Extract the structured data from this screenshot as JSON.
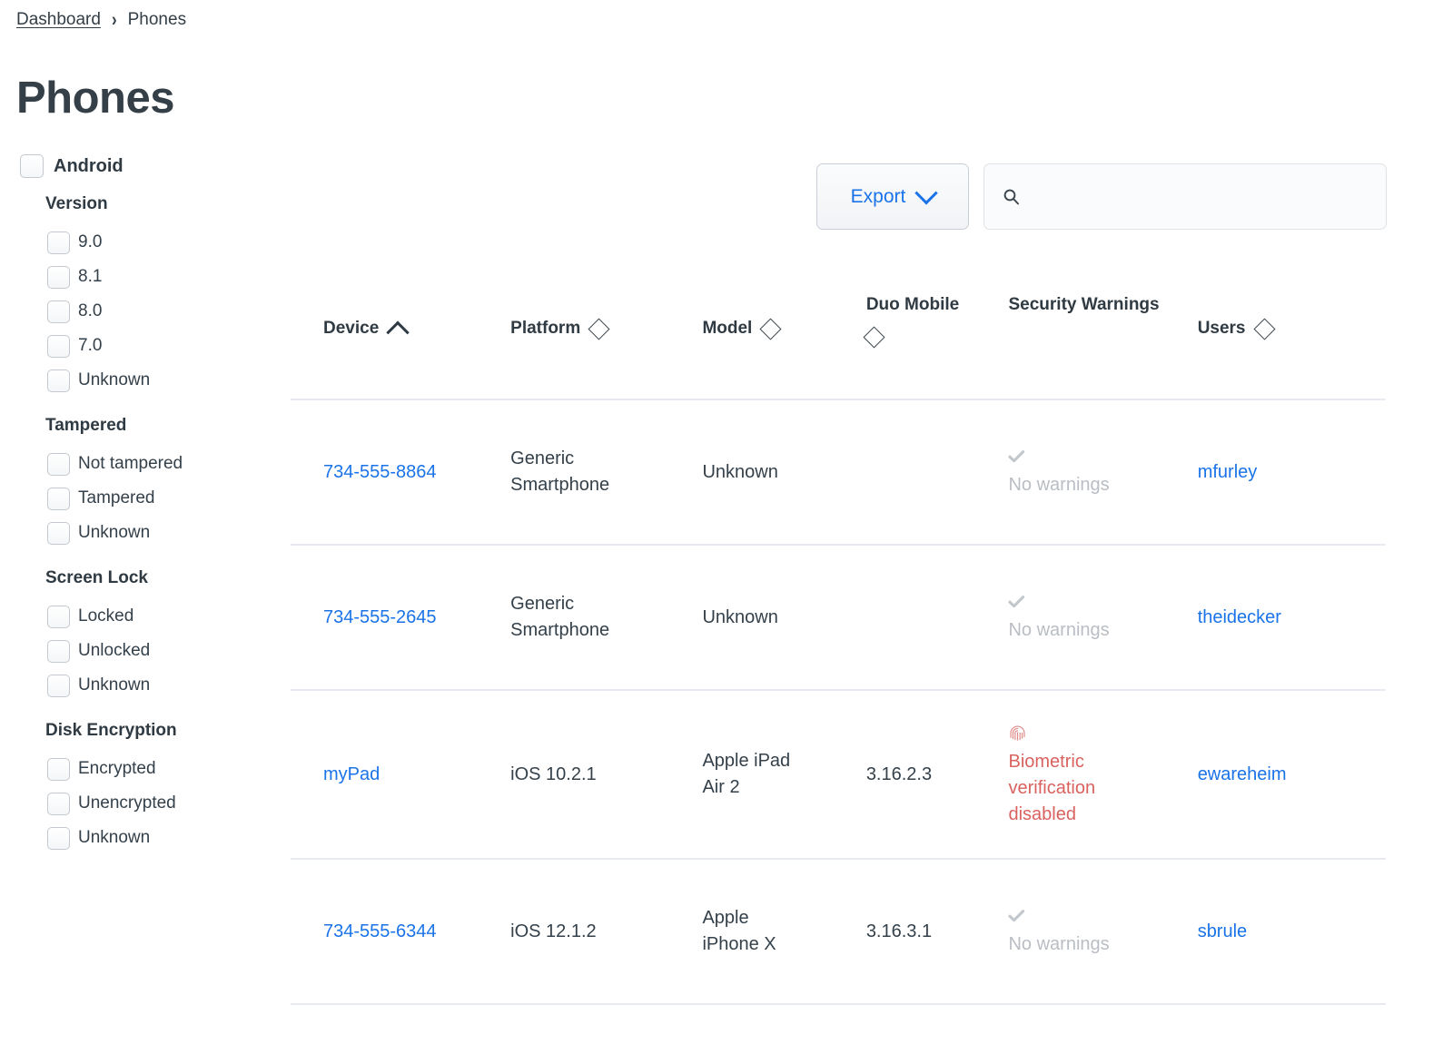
{
  "breadcrumb": {
    "parent": "Dashboard",
    "separator": "›",
    "current": "Phones"
  },
  "page": {
    "title": "Phones",
    "accent_color": "#1a73e8",
    "text_color": "#34404a",
    "warning_color": "#d9625f",
    "muted_color": "#b9bec4",
    "divider_color": "#e7eaf1"
  },
  "toolbar": {
    "export_label": "Export",
    "export_caret_icon": "chevron-down-icon",
    "search_icon": "search-icon",
    "search_value": "",
    "search_placeholder": ""
  },
  "filters": {
    "root": {
      "label": "Android",
      "checked": false
    },
    "groups": [
      {
        "title": "Version",
        "items": [
          {
            "label": "9.0",
            "checked": false
          },
          {
            "label": "8.1",
            "checked": false
          },
          {
            "label": "8.0",
            "checked": false
          },
          {
            "label": "7.0",
            "checked": false
          },
          {
            "label": "Unknown",
            "checked": false
          }
        ]
      },
      {
        "title": "Tampered",
        "items": [
          {
            "label": "Not tampered",
            "checked": false
          },
          {
            "label": "Tampered",
            "checked": false
          },
          {
            "label": "Unknown",
            "checked": false
          }
        ]
      },
      {
        "title": "Screen Lock",
        "items": [
          {
            "label": "Locked",
            "checked": false
          },
          {
            "label": "Unlocked",
            "checked": false
          },
          {
            "label": "Unknown",
            "checked": false
          }
        ]
      },
      {
        "title": "Disk Encryption",
        "items": [
          {
            "label": "Encrypted",
            "checked": false
          },
          {
            "label": "Unencrypted",
            "checked": false
          },
          {
            "label": "Unknown",
            "checked": false
          }
        ]
      }
    ]
  },
  "table": {
    "columns": [
      {
        "label": "Device",
        "sort": "asc",
        "sort_icon": "chevron-up-icon"
      },
      {
        "label": "Platform",
        "sort": "none",
        "sort_icon": "sort-diamond-icon"
      },
      {
        "label": "Model",
        "sort": "none",
        "sort_icon": "sort-diamond-icon"
      },
      {
        "label": "Duo Mobile",
        "sort": "none",
        "sort_icon": "sort-diamond-icon"
      },
      {
        "label": "Security Warnings",
        "sort": null,
        "sort_icon": null
      },
      {
        "label": "Users",
        "sort": "none",
        "sort_icon": "sort-diamond-icon"
      }
    ],
    "rows": [
      {
        "device": "734-555-8864",
        "platform": "Generic Smartphone",
        "model": "Unknown",
        "duo_mobile": "",
        "warning_type": "none",
        "warning_icon": "check-icon",
        "warning_text": "No warnings",
        "user": "mfurley"
      },
      {
        "device": "734-555-2645",
        "platform": "Generic Smartphone",
        "model": "Unknown",
        "duo_mobile": "",
        "warning_type": "none",
        "warning_icon": "check-icon",
        "warning_text": "No warnings",
        "user": "theidecker"
      },
      {
        "device": "myPad",
        "platform": "iOS 10.2.1",
        "model": "Apple iPad Air 2",
        "duo_mobile": "3.16.2.3",
        "warning_type": "biometric",
        "warning_icon": "fingerprint-icon",
        "warning_text": "Biometric verification disabled",
        "user": "ewareheim"
      },
      {
        "device": "734-555-6344",
        "platform": "iOS 12.1.2",
        "model": "Apple iPhone X",
        "duo_mobile": "3.16.3.1",
        "warning_type": "none",
        "warning_icon": "check-icon",
        "warning_text": "No warnings",
        "user": "sbrule"
      }
    ]
  }
}
